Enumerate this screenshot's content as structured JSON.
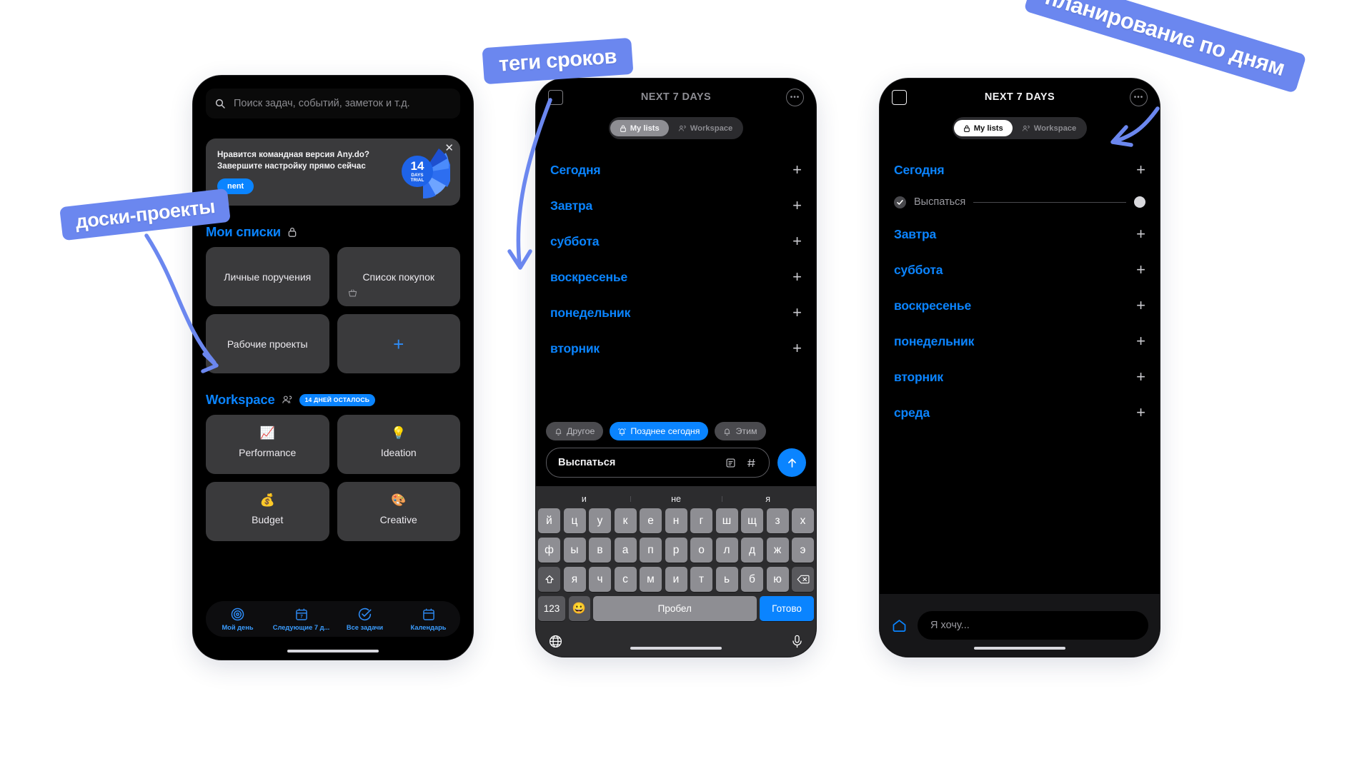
{
  "annotations": [
    {
      "id": "anno1",
      "text": "доски-проекты"
    },
    {
      "id": "anno2",
      "text": "теги сроков"
    },
    {
      "id": "anno3",
      "text": "планирование по дням"
    }
  ],
  "colors": {
    "accent_blue": "#0a84ff",
    "annotation_blue": "#6b87ef",
    "tile_gray": "#3a3a3c",
    "screen_black": "#000000"
  },
  "phone1": {
    "search": {
      "placeholder": "Поиск задач, событий, заметок и т.д.",
      "icon": "search-icon"
    },
    "promo": {
      "line1": "Нравится командная версия Any.do?",
      "line2": "Завершите настройку прямо сейчас",
      "button_label": "nent",
      "close_icon": "close-icon",
      "badge": {
        "number": "14",
        "line1": "DAYS",
        "line2": "TRIAL"
      }
    },
    "my_lists": {
      "title": "Мои списки",
      "icon": "lock-icon",
      "tiles": [
        {
          "label": "Личные поручения",
          "corner_icon": ""
        },
        {
          "label": "Список покупок",
          "corner_icon": "basket-icon"
        },
        {
          "label": "Рабочие проекты",
          "corner_icon": ""
        },
        {
          "label": "",
          "add": true
        }
      ]
    },
    "workspace": {
      "title": "Workspace",
      "icon": "people-icon",
      "trial_badge": "14 ДНЕЙ ОСТАЛОСЬ",
      "tiles": [
        {
          "label": "Performance",
          "emoji": "📈"
        },
        {
          "label": "Ideation",
          "emoji": "💡"
        },
        {
          "label": "Budget",
          "emoji": "💰"
        },
        {
          "label": "Creative",
          "emoji": "🎨"
        }
      ]
    },
    "tabbar": [
      {
        "label": "Мой день",
        "icon": "target-icon"
      },
      {
        "label": "Следующие 7 д...",
        "icon": "calendar-7-icon"
      },
      {
        "label": "Все задачи",
        "icon": "check-circle-icon"
      },
      {
        "label": "Календарь",
        "icon": "calendar-icon"
      }
    ]
  },
  "phone2": {
    "topbar": {
      "title": "NEXT 7 DAYS",
      "left_icon": "checkbox-icon",
      "right_icon": "more-dots-icon"
    },
    "segments": [
      {
        "label": "My lists",
        "icon": "lock-icon",
        "active": true
      },
      {
        "label": "Workspace",
        "icon": "people-icon",
        "active": false
      }
    ],
    "days": [
      {
        "label": "Сегодня"
      },
      {
        "label": "Завтра"
      },
      {
        "label": "суббота"
      },
      {
        "label": "воскресенье"
      },
      {
        "label": "понедельник"
      },
      {
        "label": "вторник"
      }
    ],
    "tags": [
      {
        "label": "Другое",
        "icon": "bell-icon",
        "selected": false
      },
      {
        "label": "Позднее сегодня",
        "icon": "bell-ring-icon",
        "selected": true
      },
      {
        "label": "Этим",
        "icon": "bell-icon",
        "selected": false
      }
    ],
    "composer": {
      "value": "Выспаться",
      "note_icon": "note-icon",
      "tag_icon": "hash-icon",
      "send_icon": "arrow-up-icon"
    },
    "keyboard": {
      "predictions": [
        "и",
        "не",
        "я"
      ],
      "row1": [
        "й",
        "ц",
        "у",
        "к",
        "е",
        "н",
        "г",
        "ш",
        "щ",
        "з",
        "х"
      ],
      "row2": [
        "ф",
        "ы",
        "в",
        "а",
        "п",
        "р",
        "о",
        "л",
        "д",
        "ж",
        "э"
      ],
      "row3": [
        "я",
        "ч",
        "с",
        "м",
        "и",
        "т",
        "ь",
        "б",
        "ю"
      ],
      "shift_icon": "shift-icon",
      "backspace_icon": "backspace-icon",
      "numbers_key": "123",
      "emoji_key": "😀",
      "space_key": "Пробел",
      "done_key": "Готово",
      "globe_icon": "globe-icon",
      "mic_icon": "mic-icon"
    }
  },
  "phone3": {
    "topbar": {
      "title": "NEXT 7 DAYS",
      "left_icon": "checkbox-icon",
      "right_icon": "more-dots-icon"
    },
    "segments": [
      {
        "label": "My lists",
        "icon": "lock-icon",
        "active": true
      },
      {
        "label": "Workspace",
        "icon": "people-icon",
        "active": false
      }
    ],
    "days": [
      {
        "label": "Сегодня",
        "task": {
          "text": "Выспаться",
          "done": true
        }
      },
      {
        "label": "Завтра"
      },
      {
        "label": "суббота"
      },
      {
        "label": "воскресенье"
      },
      {
        "label": "понедельник"
      },
      {
        "label": "вторник"
      },
      {
        "label": "среда"
      }
    ],
    "bottom": {
      "home_icon": "home-icon",
      "input_placeholder": "Я хочу..."
    }
  }
}
